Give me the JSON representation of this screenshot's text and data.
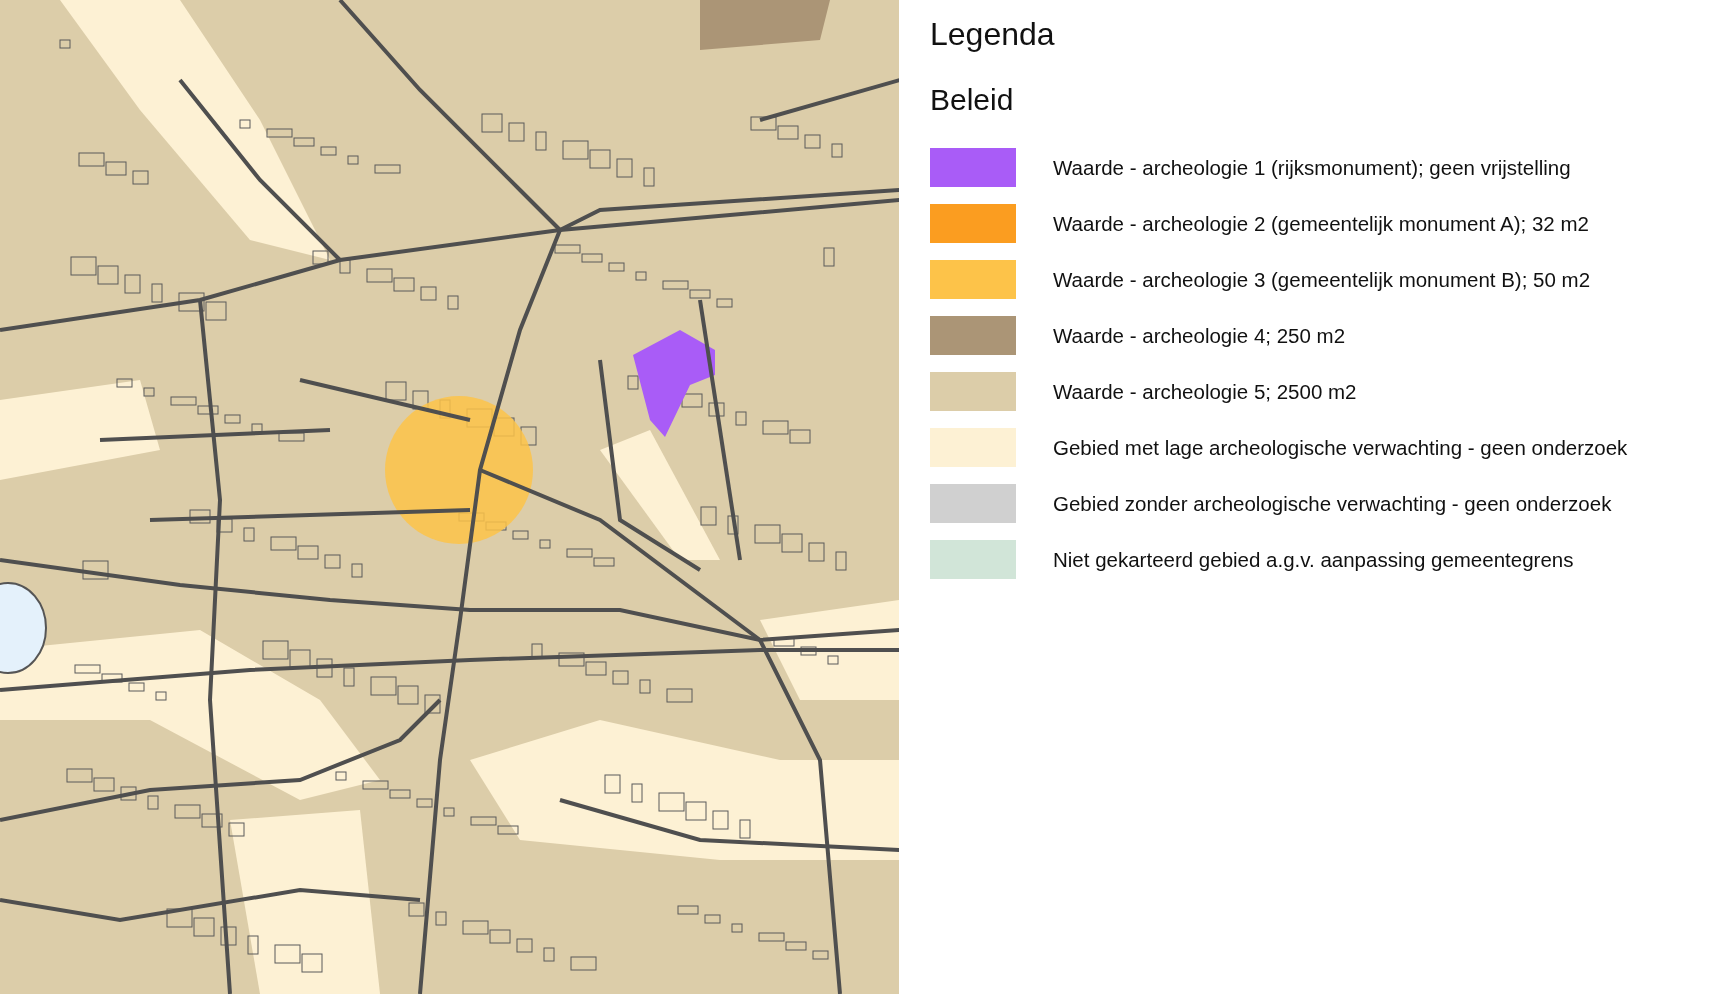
{
  "legend": {
    "title": "Legenda",
    "section": "Beleid",
    "items": [
      {
        "label": "Waarde - archeologie 1 (rijksmonument); geen vrijstelling",
        "color": "#a95cf7"
      },
      {
        "label": "Waarde - archeologie 2 (gemeentelijk monument A); 32 m2",
        "color": "#fb9d20"
      },
      {
        "label": "Waarde - archeologie 3 (gemeentelijk monument B); 50 m2",
        "color": "#fdc349"
      },
      {
        "label": "Waarde - archeologie 4; 250 m2",
        "color": "#ab9576"
      },
      {
        "label": "Waarde - archeologie 5; 2500 m2",
        "color": "#dccda9"
      },
      {
        "label": "Gebied met lage archeologische verwachting - geen onderzoek",
        "color": "#fdf1d4"
      },
      {
        "label": "Gebied zonder archeologische verwachting - geen onderzoek",
        "color": "#d0d0d0"
      },
      {
        "label": "Niet gekarteerd gebied a.g.v. aanpassing gemeentegrens",
        "color": "#d1e5d8"
      }
    ]
  }
}
